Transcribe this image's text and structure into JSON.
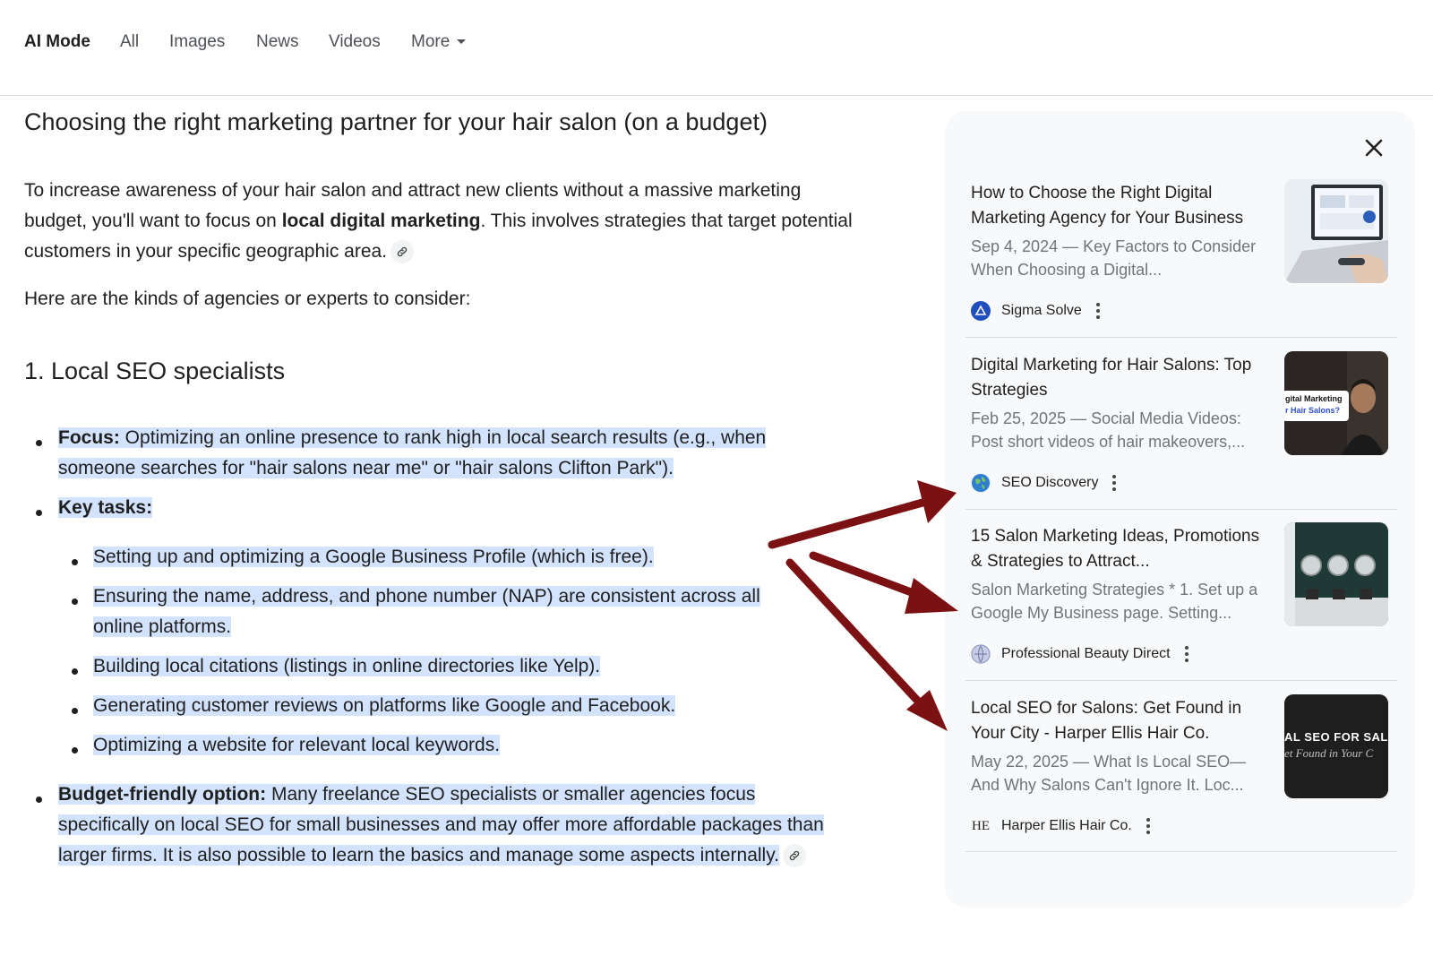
{
  "nav": {
    "items": [
      "AI Mode",
      "All",
      "Images",
      "News",
      "Videos"
    ],
    "more_label": "More"
  },
  "main": {
    "title": "Choosing the right marketing partner for your hair salon (on a budget)",
    "intro_part1": "To increase awareness of your hair salon and attract new clients without a massive marketing budget, you'll want to focus on ",
    "intro_bold": "local digital marketing",
    "intro_part2": ". This involves strategies that target potential customers in your specific geographic area.",
    "lead": "Here are the kinds of agencies or experts to consider:",
    "section_heading": "1. Local SEO specialists",
    "focus_label": "Focus:",
    "focus_text": " Optimizing an online presence to rank high in local search results (e.g., when someone searches for \"hair salons near me\" or \"hair salons Clifton Park\").",
    "key_tasks_label": "Key tasks:",
    "tasks": [
      "Setting up and optimizing a Google Business Profile (which is free).",
      "Ensuring the name, address, and phone number (NAP) are consistent across all online platforms.",
      "Building local citations (listings in online directories like Yelp).",
      "Generating customer reviews on platforms like Google and Facebook.",
      "Optimizing a website for relevant local keywords."
    ],
    "budget_label": "Budget-friendly option:",
    "budget_text": " Many freelance SEO specialists or smaller agencies focus specifically on local SEO for small businesses and may offer more affordable packages than larger firms. It is also possible to learn the basics and manage some aspects internally."
  },
  "panel": {
    "cards": [
      {
        "title": "How to Choose the Right Digital Marketing Agency for Your Business",
        "snippet": "Sep 4, 2024 — Key Factors to Consider When Choosing a Digital...",
        "source": "Sigma Solve",
        "icon": "sigma-solve-favicon"
      },
      {
        "title": "Digital Marketing for Hair Salons: Top Strategies",
        "snippet": "Feb 25, 2025 — Social Media Videos: Post short videos of hair makeovers,...",
        "source": "SEO Discovery",
        "icon": "globe-favicon"
      },
      {
        "title": "15 Salon Marketing Ideas, Promotions & Strategies to Attract...",
        "snippet": "Salon Marketing Strategies * 1. Set up a Google My Business page. Setting...",
        "source": "Professional Beauty Direct",
        "icon": "globe-favicon"
      },
      {
        "title": "Local SEO for Salons: Get Found in Your City - Harper Ellis Hair Co.",
        "snippet": "May 22, 2025 — What Is Local SEO— And Why Salons Can't Ignore It. Loc...",
        "source": "Harper Ellis Hair Co.",
        "icon": "he-monogram-favicon",
        "favicon_text": "HE"
      }
    ],
    "thumb2_line1": "gital Marketing",
    "thumb2_line2": "r Hair Salons?",
    "thumb4_line1": "AL SEO FOR SALO",
    "thumb4_line2": "et Found in Your C"
  },
  "colors": {
    "highlight": "#d3e3fd",
    "arrow": "#7b1113",
    "panel_bg": "#f8f9fa",
    "snippet": "#70757a"
  }
}
